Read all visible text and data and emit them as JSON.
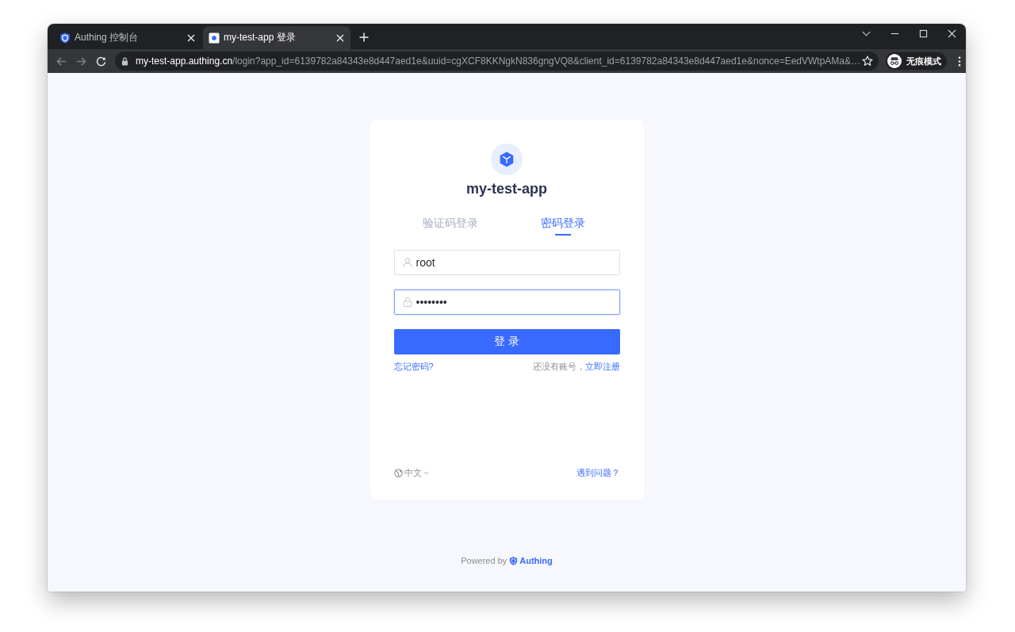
{
  "browser": {
    "tabs": [
      {
        "kind": "shield",
        "title": "Authing 控制台",
        "selected": false
      },
      {
        "kind": "app",
        "title": "my-test-app 登录",
        "selected": true
      }
    ],
    "nav_buttons": [
      {
        "kind": "back",
        "disabled": true
      },
      {
        "kind": "forward",
        "disabled": true
      },
      {
        "kind": "reload",
        "disabled": false
      }
    ],
    "address_bar": {
      "host": "my-test-app.authing.cn",
      "path": "/login?app_id=6139782a84343e8d447aed1e&uuid=cgXCF8KKNgkN836gngVQ8&client_id=6139782a84343e8d447aed1e&nonce=EedVWtpAMa&…"
    },
    "profile_badge": "无痕模式"
  },
  "login_card": {
    "app_name": "my-test-app",
    "tabs": [
      {
        "label": "验证码登录",
        "selected": false
      },
      {
        "label": "密码登录",
        "selected": true
      }
    ],
    "fields": [
      {
        "kind": "username",
        "value": "root",
        "focused": false
      },
      {
        "kind": "password",
        "value": "••••••••",
        "focused": true
      }
    ],
    "submit_button": "登 录",
    "forgot_password_link": "忘记密码?",
    "signup_prompt": "还没有账号，",
    "signup_link": "立即注册",
    "language": "中文",
    "help_link": "遇到问题？"
  },
  "footer": {
    "powered_by": "Powered by",
    "brand": "Authing"
  }
}
